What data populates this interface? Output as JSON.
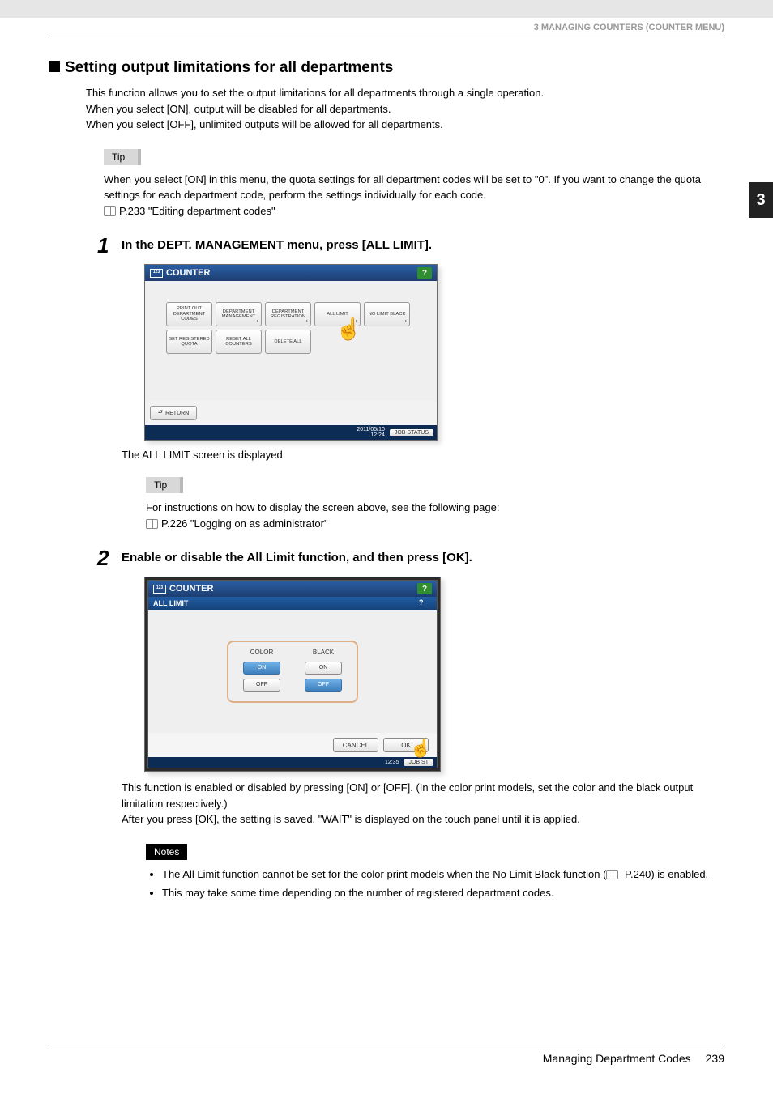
{
  "header": {
    "chapter": "3 MANAGING COUNTERS (COUNTER MENU)",
    "tab": "3"
  },
  "section": {
    "title": "Setting output limitations for all departments"
  },
  "intro": {
    "l1": "This function allows you to set the output limitations for all departments through a single operation.",
    "l2": "When you select [ON], output will be disabled for all departments.",
    "l3": "When you select [OFF], unlimited outputs will be allowed for all departments."
  },
  "tip1": {
    "label": "Tip",
    "body": "When you select [ON] in this menu, the quota settings for all department codes will be set to \"0\". If you want to change the quota settings for each department code, perform the settings individually for each code.",
    "ref": "P.233 \"Editing department codes\""
  },
  "step1": {
    "num": "1",
    "text": "In the DEPT. MANAGEMENT menu, press [ALL LIMIT].",
    "screen": {
      "title": "COUNTER",
      "buttons": {
        "b0": "PRINT OUT DEPARTMENT CODES",
        "b1": "DEPARTMENT MANAGEMENT",
        "b2": "DEPARTMENT REGISTRATION",
        "b3": "ALL LIMIT",
        "b4": "NO LIMIT BLACK",
        "b5": "SET REGISTERED QUOTA",
        "b6": "RESET ALL COUNTERS",
        "b7": "DELETE ALL"
      },
      "return": "RETURN",
      "datetime": "2011/05/10\n12:24",
      "jobstatus": "JOB STATUS"
    },
    "after": "The ALL LIMIT screen is displayed."
  },
  "tip2": {
    "label": "Tip",
    "body": "For instructions on how to display the screen above, see the following page:",
    "ref": "P.226 \"Logging on as administrator\""
  },
  "step2": {
    "num": "2",
    "text": "Enable or disable the All Limit function, and then press [OK].",
    "screen": {
      "title": "COUNTER",
      "subtitle": "ALL LIMIT",
      "colColor": "COLOR",
      "colBlack": "BLACK",
      "on": "ON",
      "off": "OFF",
      "cancel": "CANCEL",
      "ok": "OK",
      "datetime": "12:35",
      "jobstatus": "JOB ST"
    },
    "after1": "This function is enabled or disabled by pressing [ON] or [OFF]. (In the color print models, set the color and the black output limitation respectively.)",
    "after2": "After you press [OK], the setting is saved. \"WAIT\" is displayed on the touch panel until it is applied."
  },
  "notes": {
    "label": "Notes",
    "n1a": "The All Limit function cannot be set for the color print models when the No Limit Black function (",
    "n1b": " P.240) is enabled.",
    "n2": "This may take some time depending on the number of registered department codes."
  },
  "footer": {
    "title": "Managing Department Codes",
    "page": "239"
  }
}
